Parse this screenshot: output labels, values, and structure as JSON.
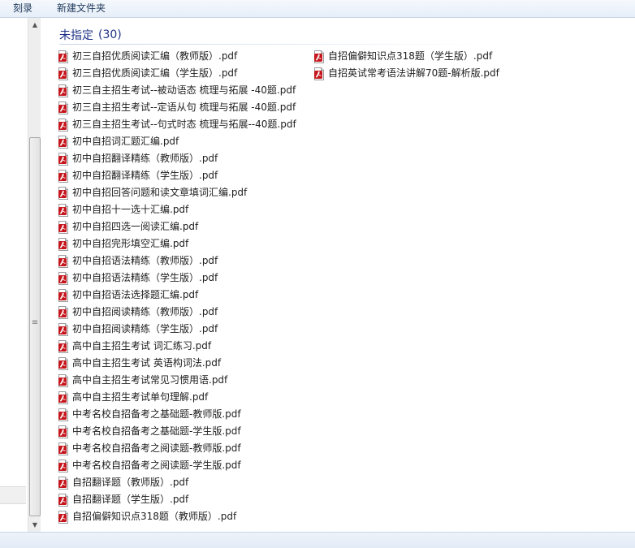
{
  "toolbar": {
    "burn_label": "刻录",
    "new_folder_label": "新建文件夹"
  },
  "group": {
    "title": "未指定",
    "count": "(30)"
  },
  "files_col1": [
    "初三自招优质阅读汇编（教师版）.pdf",
    "初三自招优质阅读汇编（学生版）.pdf",
    "初三自主招生考试--被动语态 梳理与拓展 -40题.pdf",
    "初三自主招生考试--定语从句 梳理与拓展 -40题.pdf",
    "初三自主招生考试--句式时态 梳理与拓展--40题.pdf",
    "初中自招词汇题汇编.pdf",
    "初中自招翻译精练（教师版）.pdf",
    "初中自招翻译精练（学生版）.pdf",
    "初中自招回答问题和读文章填词汇编.pdf",
    "初中自招十一选十汇编.pdf",
    "初中自招四选一阅读汇编.pdf",
    "初中自招完形填空汇编.pdf",
    "初中自招语法精练（教师版）.pdf",
    "初中自招语法精练（学生版）.pdf",
    "初中自招语法选择题汇编.pdf",
    "初中自招阅读精练（教师版）.pdf",
    "初中自招阅读精练（学生版）.pdf",
    "高中自主招生考试 词汇练习.pdf",
    "高中自主招生考试 英语构词法.pdf",
    "高中自主招生考试常见习惯用语.pdf",
    "高中自主招生考试单句理解.pdf",
    "中考名校自招备考之基础题-教师版.pdf",
    "中考名校自招备考之基础题-学生版.pdf",
    "中考名校自招备考之阅读题-教师版.pdf",
    "中考名校自招备考之阅读题-学生版.pdf",
    "自招翻译题（教师版）.pdf",
    "自招翻译题（学生版）.pdf",
    "自招偏僻知识点318题（教师版）.pdf"
  ],
  "files_col2": [
    "自招偏僻知识点318题（学生版）.pdf",
    "自招英试常考语法讲解70题-解析版.pdf"
  ],
  "icons": {
    "file": "pdf-file-icon",
    "scroll_up": "scroll-up-arrow-icon",
    "scroll_down": "scroll-down-arrow-icon",
    "grip": "scroll-grip-icon"
  },
  "colors": {
    "group_title": "#1e3287",
    "pdf_red": "#c4161c"
  }
}
